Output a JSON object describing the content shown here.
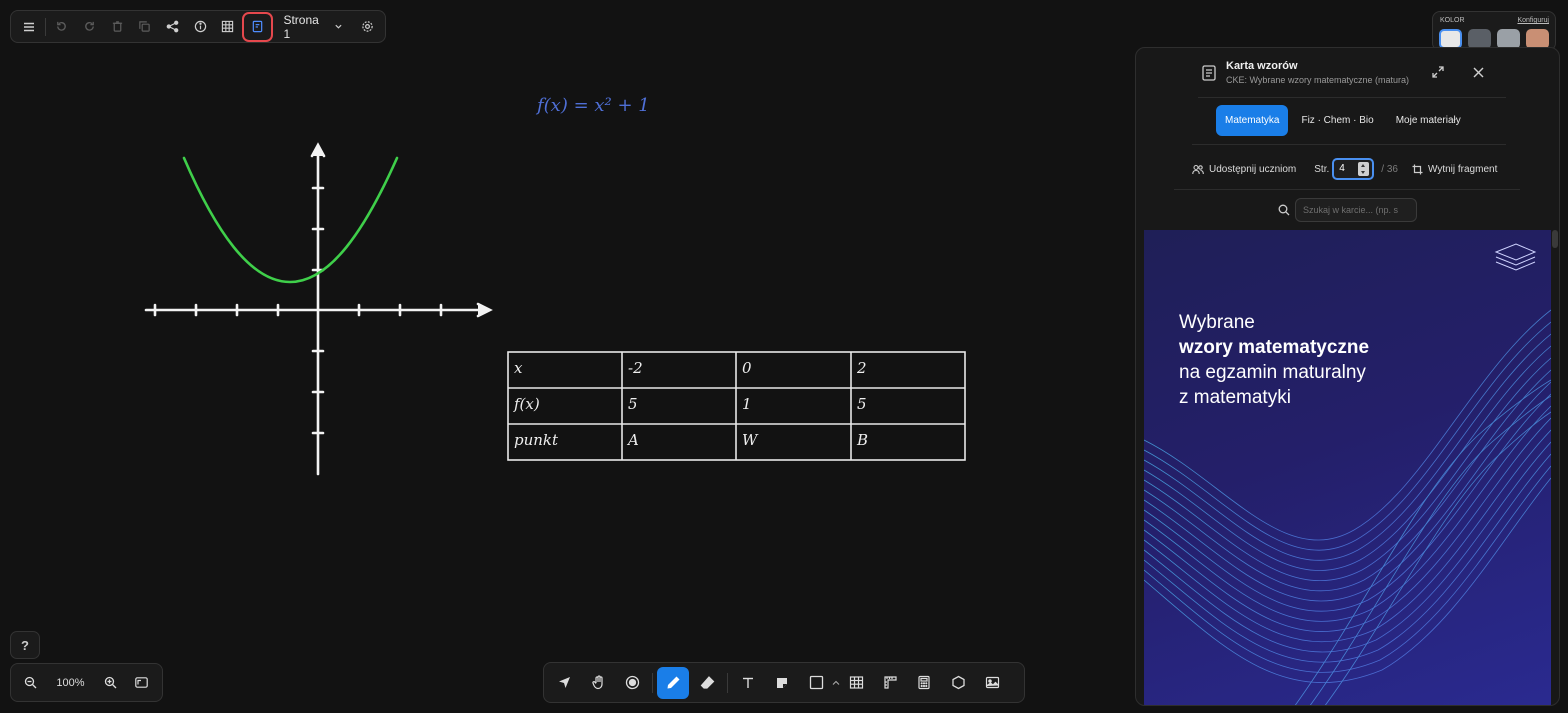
{
  "toolbar_top": {
    "page_label": "Strona 1",
    "icons": [
      "menu-icon",
      "undo-icon",
      "redo-icon",
      "trash-icon",
      "duplicate-icon",
      "share-icon",
      "info-icon",
      "grid-icon",
      "formula-sheet-icon",
      "settings-icon"
    ]
  },
  "color_panel": {
    "label": "KOLOR",
    "configure": "Konfiguruj",
    "swatches": [
      "#e8e8e8",
      "#5a5f66",
      "#9aa0a6",
      "#c98f74"
    ]
  },
  "canvas": {
    "formula": "f(x) = x² + 1",
    "curve_color": "#3fcf4a",
    "formula_color": "#4f6fd6",
    "table": {
      "rows": [
        [
          "x",
          "-2",
          "0",
          "2"
        ],
        [
          "f(x)",
          "5",
          "1",
          "5"
        ],
        [
          "punkt",
          "A",
          "W",
          "B"
        ]
      ]
    }
  },
  "panel": {
    "title": "Karta wzorów",
    "subtitle": "CKE: Wybrane wzory matematyczne (matura)",
    "tabs": [
      "Matematyka",
      "Fiz · Chem · Bio",
      "Moje materiały"
    ],
    "active_tab": "Matematyka",
    "share_label": "Udostępnij uczniom",
    "page_prefix": "Str.",
    "page_value": "4",
    "page_total": "/ 36",
    "cut_label": "Wytnij fragment",
    "search_placeholder": "Szukaj w karcie... (np. s",
    "cover": {
      "line1": "Wybrane",
      "line2": "wzory matematyczne",
      "line3": "na egzamin maturalny",
      "line4": "z matematyki"
    }
  },
  "zoom": {
    "level": "100%",
    "help": "?"
  },
  "bottom_tools": [
    "select-icon",
    "hand-icon",
    "laser-icon",
    "pen-icon",
    "eraser-icon",
    "text-icon",
    "sticky-note-icon",
    "shape-icon",
    "table-icon",
    "ruler-icon",
    "calculator-icon",
    "polygon-icon",
    "image-icon"
  ],
  "active_tool": "pen-icon"
}
